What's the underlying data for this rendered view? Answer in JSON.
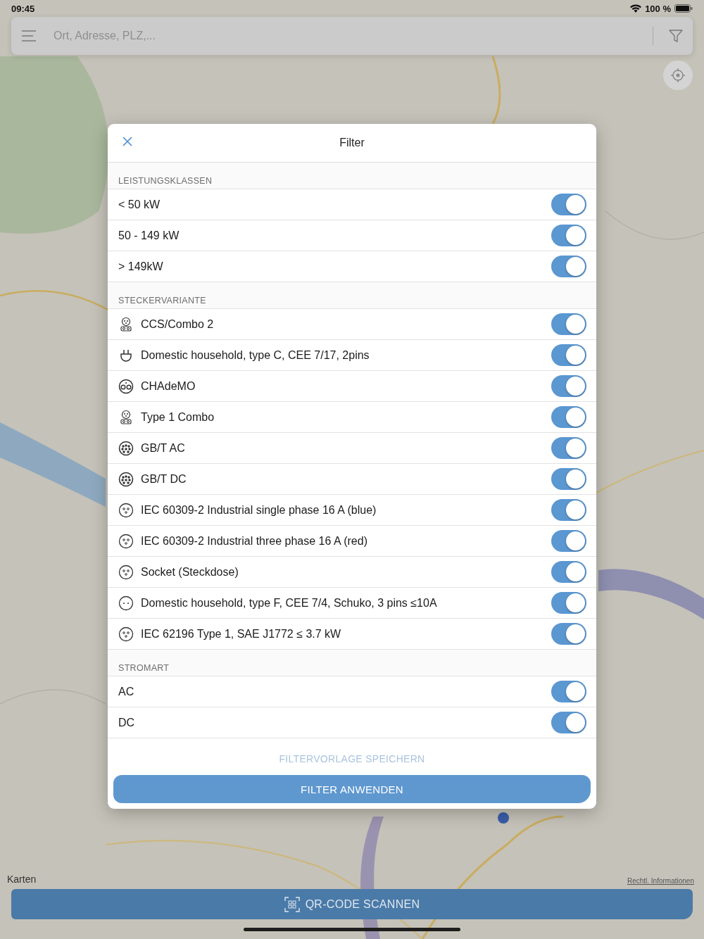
{
  "status_bar": {
    "time": "09:45",
    "battery": "100 %"
  },
  "search": {
    "placeholder": "Ort, Adresse, PLZ,..."
  },
  "map": {
    "kind": "picture",
    "brand": "Karten",
    "legal_link": "Rechtl. Informationen"
  },
  "filter": {
    "title": "Filter",
    "sections": [
      {
        "title": "LEISTUNGSKLASSEN",
        "rows": [
          {
            "label": "< 50 kW",
            "on": true
          },
          {
            "label": "50 - 149 kW",
            "on": true
          },
          {
            "label": "> 149kW",
            "on": true
          }
        ]
      },
      {
        "title": "STECKERVARIANTE",
        "rows": [
          {
            "label": "CCS/Combo 2",
            "on": true,
            "kind": "combo"
          },
          {
            "label": "Domestic household, type C, CEE 7/17, 2pins",
            "on": true,
            "kind": "plug"
          },
          {
            "label": "CHAdeMO",
            "on": true,
            "kind": "twin"
          },
          {
            "label": "Type 1 Combo",
            "on": true,
            "kind": "combo"
          },
          {
            "label": "GB/T AC",
            "on": true,
            "kind": "dense"
          },
          {
            "label": "GB/T DC",
            "on": true,
            "kind": "dense"
          },
          {
            "label": "IEC 60309-2 Industrial single phase 16 A (blue)",
            "on": true,
            "kind": "round"
          },
          {
            "label": "IEC 60309-2 Industrial three phase 16 A (red)",
            "on": true,
            "kind": "round"
          },
          {
            "label": "Socket (Steckdose)",
            "on": true,
            "kind": "round"
          },
          {
            "label": "Domestic household, type F, CEE 7/4, Schuko, 3 pins ≤10A",
            "on": true,
            "kind": "schuko"
          },
          {
            "label": "IEC 62196 Type 1, SAE J1772 ≤ 3.7 kW",
            "on": true,
            "kind": "round"
          }
        ]
      },
      {
        "title": "STROMART",
        "rows": [
          {
            "label": "AC",
            "on": true
          },
          {
            "label": "DC",
            "on": true
          }
        ]
      }
    ],
    "save_template": {
      "label": "FILTERVORLAGE SPEICHERN",
      "disabled": true
    },
    "apply": {
      "label": "FILTER ANWENDEN"
    }
  },
  "qr_button": {
    "label": "QR-CODE SCANNEN"
  }
}
